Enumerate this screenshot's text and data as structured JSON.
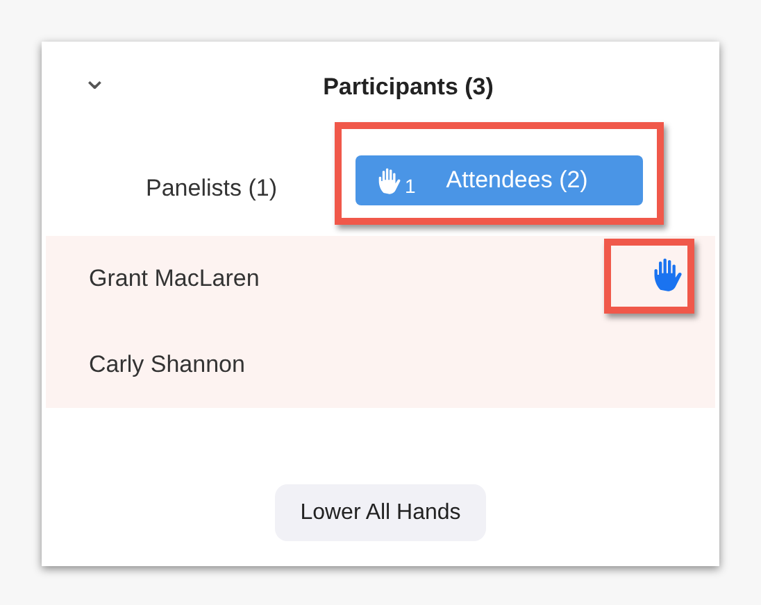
{
  "header": {
    "title": "Participants (3)",
    "collapse_icon": "⌄"
  },
  "tabs": [
    {
      "label": "Panelists (1)",
      "selected": false,
      "highlighted": false
    },
    {
      "label": "Attendees (2)",
      "selected": true,
      "highlighted": true,
      "raised_hands": "1"
    }
  ],
  "attendees": [
    {
      "name": "Grant MacLaren",
      "hand_raised": true,
      "highlighted": true
    },
    {
      "name": "Carly Shannon",
      "hand_raised": false,
      "highlighted": false
    }
  ],
  "footer_button": "Lower All Hands"
}
